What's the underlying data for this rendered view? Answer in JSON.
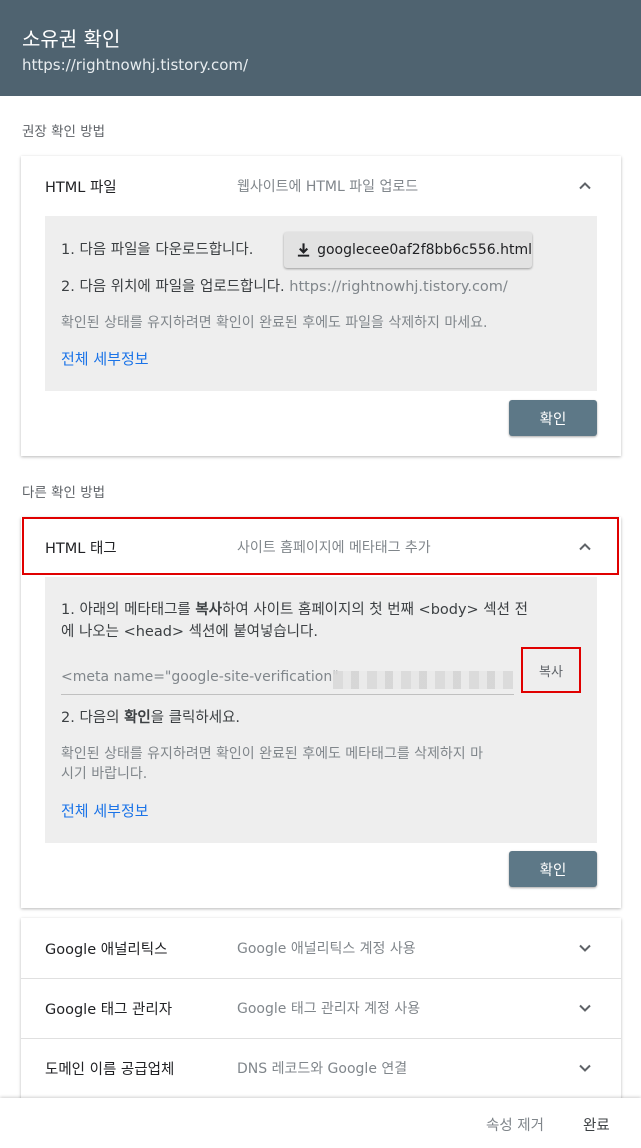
{
  "header": {
    "title": "소유권 확인",
    "url": "https://rightnowhj.tistory.com/"
  },
  "recommended": {
    "section_label": "권장 확인 방법",
    "method_name": "HTML 파일",
    "method_desc": "웹사이트에 HTML 파일 업로드",
    "step1": "1. 다음 파일을 다운로드합니다.",
    "download_file": "googlecee0af2f8bb6c556.html",
    "step2": "2. 다음 위치에 파일을 업로드합니다.",
    "step2_url": "https://rightnowhj.tistory.com/",
    "note": "확인된 상태를 유지하려면 확인이 완료된 후에도 파일을 삭제하지 마세요.",
    "details_link": "전체 세부정보",
    "confirm_label": "확인"
  },
  "other": {
    "section_label": "다른 확인 방법",
    "method_name": "HTML 태그",
    "method_desc": "사이트 홈페이지에 메타태그 추가",
    "step1_pre": "1. 아래의 메타태그를 ",
    "step1_bold": "복사",
    "step1_post": "하여 사이트 홈페이지의 첫 번째 <body> 섹션 전",
    "step1_line2": "에 나오는 <head> 섹션에 붙여넣습니다.",
    "meta_value": "<meta name=\"google-site-verification\"",
    "copy_label": "복사",
    "step2_pre": "2. 다음의 ",
    "step2_bold": "확인",
    "step2_post": "을 클릭하세요.",
    "note_line1": "확인된 상태를 유지하려면 확인이 완료된 후에도 메타태그를 삭제하지 마",
    "note_line2": "시기 바랍니다.",
    "details_link": "전체 세부정보",
    "confirm_label": "확인"
  },
  "collapsed_methods": [
    {
      "name": "Google 애널리틱스",
      "desc": "Google 애널리틱스 계정 사용"
    },
    {
      "name": "Google 태그 관리자",
      "desc": "Google 태그 관리자 계정 사용"
    },
    {
      "name": "도메인 이름 공급업체",
      "desc": "DNS 레코드와 Google 연결"
    }
  ],
  "footer": {
    "remove_label": "속성 제거",
    "done_label": "완료"
  },
  "colors": {
    "header_bg": "#4f6370",
    "confirm_bg": "#5d7887",
    "link": "#1a73e8",
    "highlight": "#e00000"
  },
  "icons": {
    "expanded": "chevron-up-icon",
    "collapsed": "chevron-down-icon",
    "download": "download-icon"
  }
}
